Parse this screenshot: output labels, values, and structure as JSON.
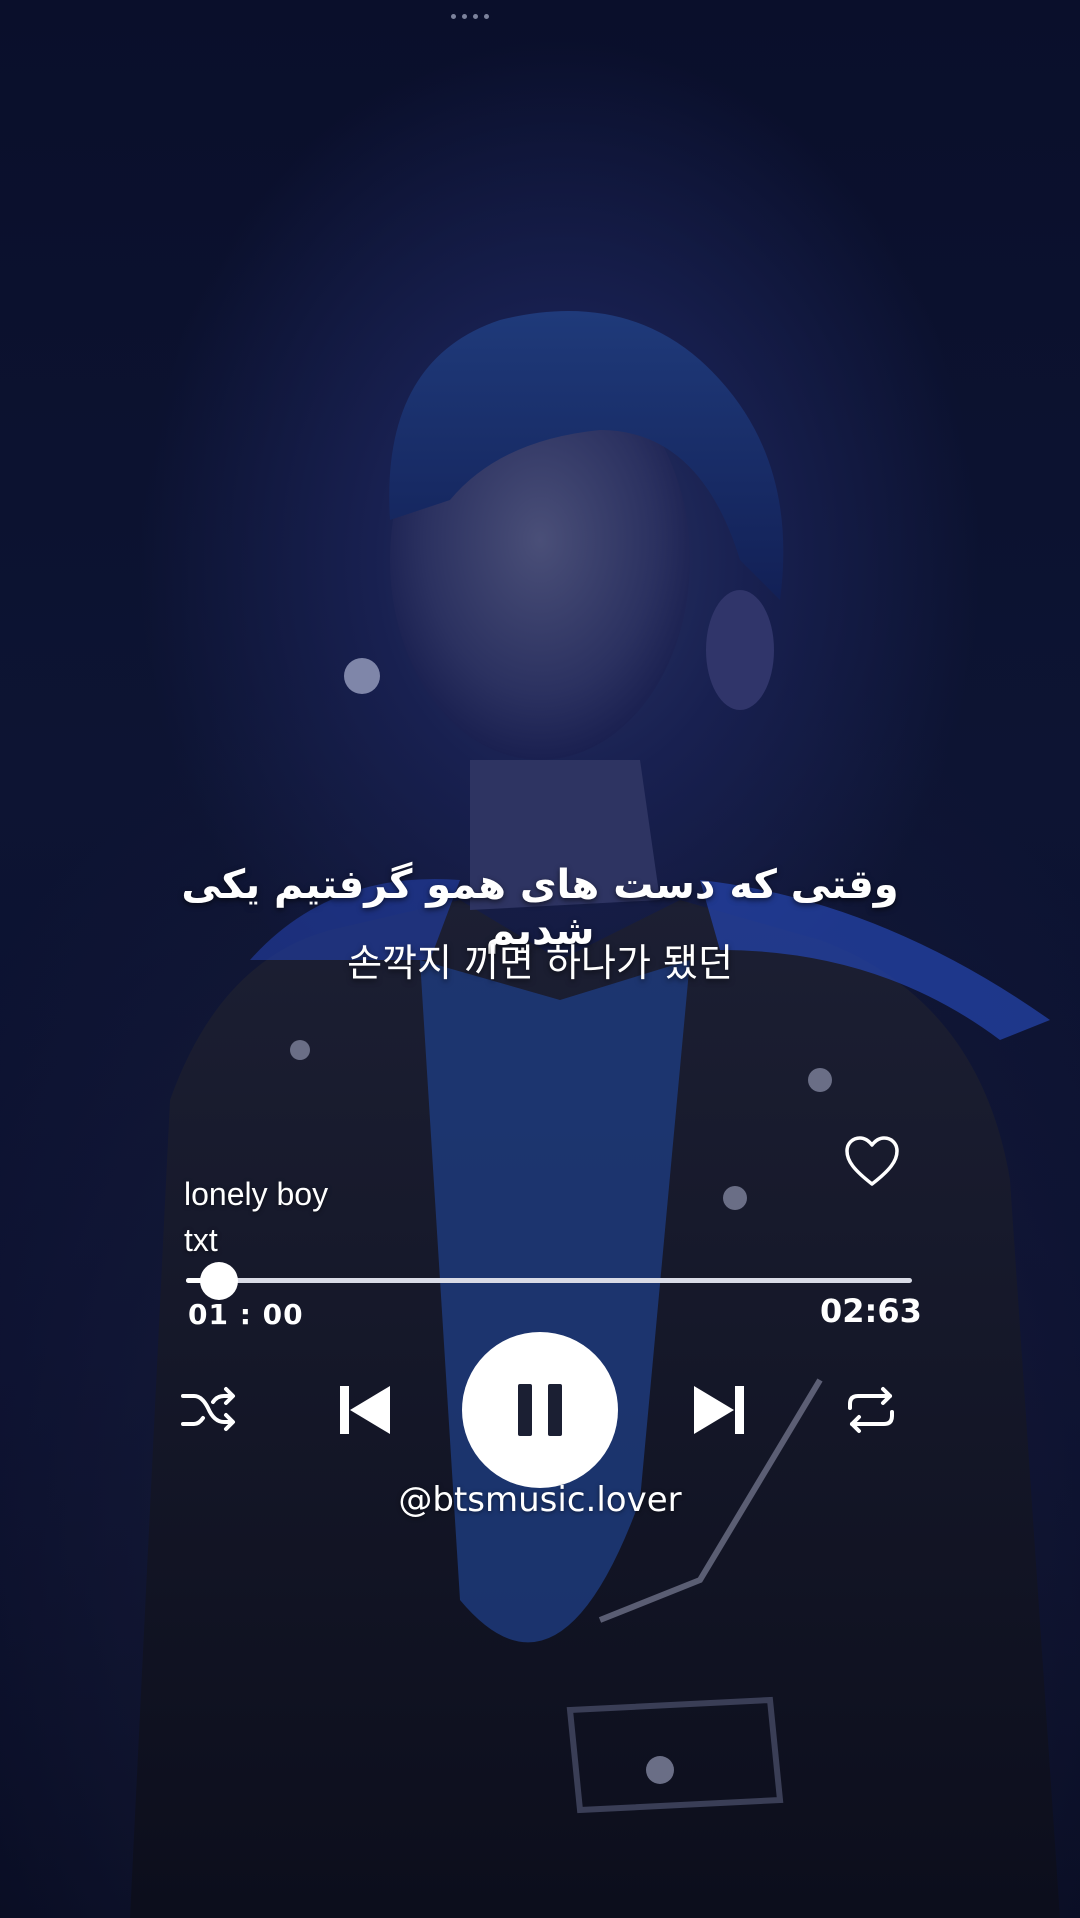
{
  "lyrics": {
    "persian": "وقتی که دست های همو گرفتیم یکی شدیم",
    "korean": "손깍지 끼면 하나가 됐던"
  },
  "track": {
    "title": "lonely boy",
    "artist": "txt"
  },
  "playback": {
    "elapsed": "01 : 00",
    "total": "02:63",
    "progress_fraction": 0.045,
    "state": "playing"
  },
  "controls": {
    "shuffle_icon": "shuffle-icon",
    "previous_icon": "skip-previous-icon",
    "play_pause_icon": "pause-icon",
    "next_icon": "skip-next-icon",
    "repeat_icon": "repeat-icon",
    "like_icon": "heart-outline-icon"
  },
  "watermark": "@btsmusic.lover",
  "colors": {
    "background": "#0a0f2a",
    "accent": "#ffffff"
  }
}
